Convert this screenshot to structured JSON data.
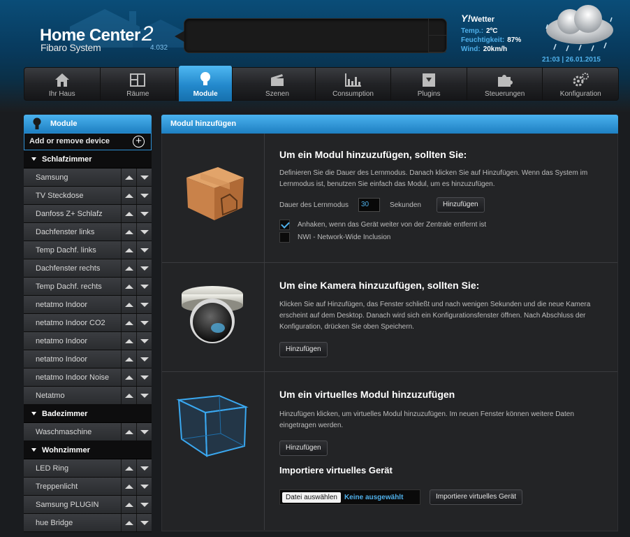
{
  "header": {
    "title": "Home Center",
    "title_suffix": "2",
    "subtitle": "Fibaro System",
    "version": "4.032"
  },
  "weather": {
    "provider": "Y!",
    "title": "Wetter",
    "temp_label": "Temp.:",
    "temp_value": "2ºC",
    "humidity_label": "Feuchtigkeit:",
    "humidity_value": "87%",
    "wind_label": "Wind:",
    "wind_value": "20km/h",
    "datetime": "21:03 | 26.01.2015"
  },
  "nav": [
    {
      "label": "Ihr Haus",
      "icon": "house-icon"
    },
    {
      "label": "Räume",
      "icon": "rooms-icon"
    },
    {
      "label": "Module",
      "icon": "bulb-icon",
      "active": true
    },
    {
      "label": "Szenen",
      "icon": "clapperboard-icon"
    },
    {
      "label": "Consumption",
      "icon": "bar-chart-icon"
    },
    {
      "label": "Plugins",
      "icon": "download-box-icon"
    },
    {
      "label": "Steuerungen",
      "icon": "puzzle-icon"
    },
    {
      "label": "Konfiguration",
      "icon": "gears-icon"
    }
  ],
  "sidebar": {
    "title": "Module",
    "add_label": "Add or remove device",
    "rooms": [
      {
        "name": "Schlafzimmer",
        "devices": [
          "Samsung",
          "TV Steckdose",
          "Danfoss Z+ Schlafz",
          "Dachfenster links",
          "Temp Dachf. links",
          "Dachfenster rechts",
          "Temp Dachf. rechts",
          "netatmo Indoor",
          "netatmo Indoor CO2",
          "netatmo Indoor",
          "netatmo Indoor",
          "netatmo Indoor Noise",
          "Netatmo"
        ]
      },
      {
        "name": "Badezimmer",
        "devices": [
          "Waschmaschine"
        ]
      },
      {
        "name": "Wohnzimmer",
        "devices": [
          "LED Ring",
          "Treppenlicht",
          "Samsung PLUGIN",
          "hue Bridge"
        ]
      }
    ]
  },
  "main": {
    "title": "Modul hinzufügen",
    "module": {
      "heading": "Um ein Modul hinzuzufügen, sollten Sie:",
      "text": "Definieren Sie die Dauer des Lernmodus. Danach klicken Sie auf Hinzufügen. Wenn das System im Lernmodus ist, benutzen Sie einfach das Modul, um es hinzuzufügen.",
      "duration_label": "Dauer des Lernmodus",
      "duration_value": "30",
      "seconds_label": "Sekunden",
      "add_button": "Hinzufügen",
      "checkbox1_label": "Anhaken, wenn das Gerät weiter von der Zentrale entfernt ist",
      "checkbox1_checked": true,
      "checkbox2_label": "NWI - Network-Wide Inclusion",
      "checkbox2_checked": false
    },
    "camera": {
      "heading": "Um eine Kamera hinzuzufügen, sollten Sie:",
      "text": "Klicken Sie auf Hinzufügen, das Fenster schließt und nach wenigen Sekunden und die neue Kamera erscheint auf dem Desktop. Danach wird sich ein Konfigurationsfenster öffnen. Nach Abschluss der Konfiguration, drücken Sie oben Speichern.",
      "add_button": "Hinzufügen"
    },
    "virtual": {
      "heading": "Um ein virtuelles Modul hinzuzufügen",
      "text": "Hinzufügen klicken, um virtuelles Modul hinzuzufügen. Im neuen Fenster können weitere Daten eingetragen werden.",
      "add_button": "Hinzufügen",
      "import_heading": "Importiere virtuelles Gerät",
      "file_button": "Datei auswählen",
      "file_none": "Keine ausgewählt",
      "import_button": "Importiere virtuelles Gerät"
    }
  },
  "colors": {
    "accent": "#4fb0ea",
    "active_tab": "#2389cc"
  }
}
